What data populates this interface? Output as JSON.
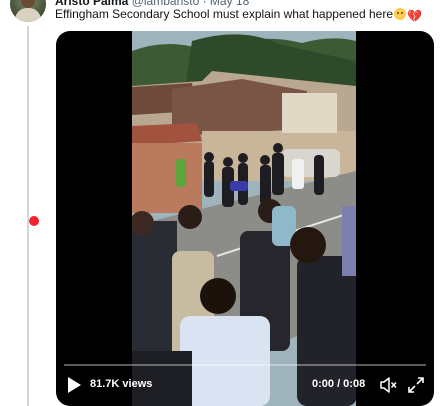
{
  "tweet": {
    "author_name": "Aristo Palma",
    "author_handle": "@lambaristo",
    "date": "· May 18",
    "text": "Effingham Secondary School  must explain what happened here",
    "emojis": [
      "sad-face-emoji",
      "broken-heart-emoji"
    ]
  },
  "video": {
    "views": "81.7K views",
    "time": "0:00 / 0:08",
    "progress": 0,
    "icons": [
      "play-icon",
      "mute-icon",
      "fullscreen-icon"
    ]
  },
  "colors": {
    "thread_line": "#cfd9de",
    "thread_dot": "#f4212e",
    "video_bg": "#000000",
    "text_primary": "#0f1419",
    "text_secondary": "#536471"
  }
}
